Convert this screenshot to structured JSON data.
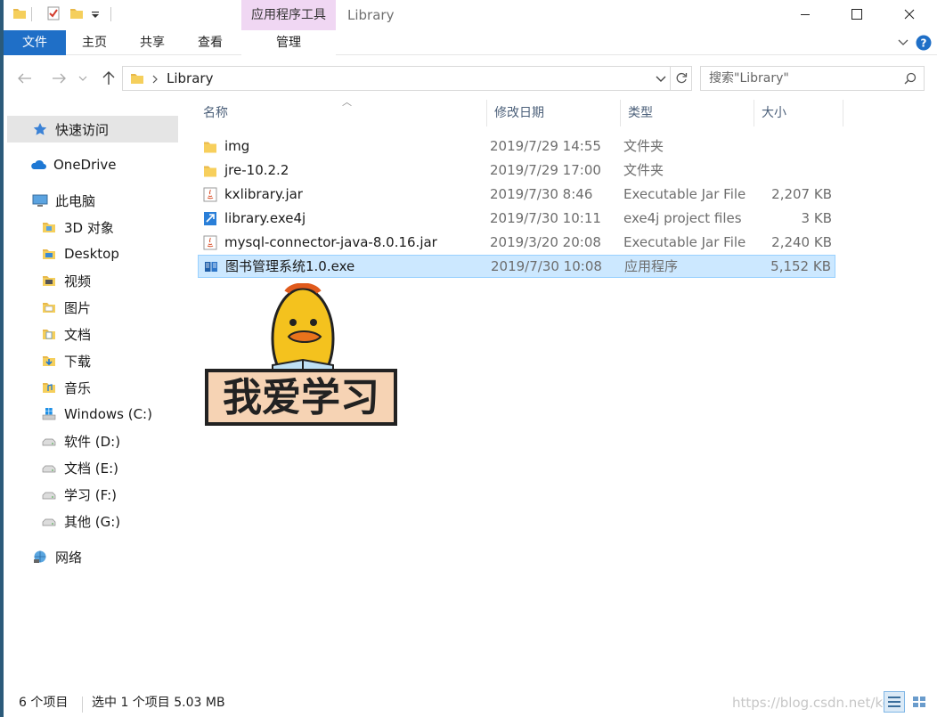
{
  "window": {
    "title": "Library",
    "context_tab": "应用程序工具"
  },
  "ribbon": {
    "tabs": [
      "文件",
      "主页",
      "共享",
      "查看",
      "管理"
    ]
  },
  "address": {
    "path": "Library",
    "search_placeholder": "搜索\"Library\""
  },
  "nav": {
    "items": [
      {
        "label": "快速访问",
        "icon": "star-icon"
      },
      {
        "label": "OneDrive",
        "icon": "cloud-icon"
      },
      {
        "label": "此电脑",
        "icon": "computer-icon"
      },
      {
        "label": "3D 对象",
        "icon": "folder-3d-icon"
      },
      {
        "label": "Desktop",
        "icon": "desktop-folder-icon"
      },
      {
        "label": "视频",
        "icon": "video-folder-icon"
      },
      {
        "label": "图片",
        "icon": "pictures-folder-icon"
      },
      {
        "label": "文档",
        "icon": "documents-folder-icon"
      },
      {
        "label": "下载",
        "icon": "downloads-folder-icon"
      },
      {
        "label": "音乐",
        "icon": "music-folder-icon"
      },
      {
        "label": "Windows (C:)",
        "icon": "windows-drive-icon"
      },
      {
        "label": "软件 (D:)",
        "icon": "drive-icon"
      },
      {
        "label": "文档 (E:)",
        "icon": "drive-icon"
      },
      {
        "label": "学习 (F:)",
        "icon": "drive-icon"
      },
      {
        "label": "其他 (G:)",
        "icon": "drive-icon"
      },
      {
        "label": "网络",
        "icon": "network-icon"
      }
    ]
  },
  "columns": {
    "name": "名称",
    "date": "修改日期",
    "type": "类型",
    "size": "大小"
  },
  "files": [
    {
      "name": "img",
      "date": "2019/7/29 14:55",
      "type": "文件夹",
      "size": "",
      "icon": "folder-icon"
    },
    {
      "name": "jre-10.2.2",
      "date": "2019/7/29 17:00",
      "type": "文件夹",
      "size": "",
      "icon": "folder-icon"
    },
    {
      "name": "kxlibrary.jar",
      "date": "2019/7/30 8:46",
      "type": "Executable Jar File",
      "size": "2,207 KB",
      "icon": "java-jar-icon"
    },
    {
      "name": "library.exe4j",
      "date": "2019/7/30 10:11",
      "type": "exe4j project files",
      "size": "3 KB",
      "icon": "exe4j-icon"
    },
    {
      "name": "mysql-connector-java-8.0.16.jar",
      "date": "2019/3/20 20:08",
      "type": "Executable Jar File",
      "size": "2,240 KB",
      "icon": "java-jar-icon"
    },
    {
      "name": "图书管理系统1.0.exe",
      "date": "2019/7/30 10:08",
      "type": "应用程序",
      "size": "5,152 KB",
      "icon": "book-app-icon",
      "selected": true
    }
  ],
  "sticker": {
    "text": "我爱学习"
  },
  "status": {
    "item_count": "6 个项目",
    "selection": "选中 1 个项目  5.03 MB",
    "watermark": "https://blog.csdn.net/ko..."
  },
  "colors": {
    "file_tab": "#1f6fc7",
    "context_tab": "#f0d7f3",
    "selection_bg": "#cce8ff",
    "selection_border": "#99d1ff"
  }
}
